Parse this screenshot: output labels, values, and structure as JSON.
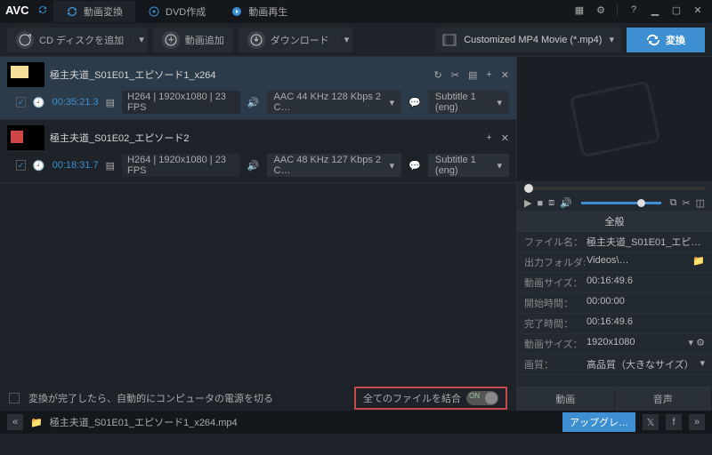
{
  "app": {
    "name": "AVC"
  },
  "main_tabs": {
    "video_convert": "動画変換",
    "dvd_create": "DVD作成",
    "video_play": "動画再生"
  },
  "toolbar": {
    "add_disc": "CD ディスクを追加",
    "add_video": "動画追加",
    "download": "ダウンロード",
    "format": "Customized MP4 Movie (*.mp4)",
    "convert": "変換"
  },
  "items": [
    {
      "name": "極主夫道_S01E01_エピソード1_x264",
      "dur": "00:35:21.3",
      "codec": "H264 | 1920x1080 | 23 FPS",
      "audio": "AAC 44 KHz 128 Kbps 2 C…",
      "sub": "Subtitle 1 (eng)"
    },
    {
      "name": "極主夫道_S01E02_エピソード2",
      "dur": "00:18:31.7",
      "codec": "H264 | 1920x1080 | 23 FPS",
      "audio": "AAC 48 KHz 127 Kbps 2 C…",
      "sub": "Subtitle 1 (eng)"
    }
  ],
  "bottom": {
    "shutdown": "変換が完了したら、自動的にコンピュータの電源を切る",
    "merge": "全てのファイルを結合",
    "merge_state": "ON"
  },
  "side": {
    "general": "全般",
    "rows": [
      {
        "k": "ファイル名：",
        "v": "極主夫道_S01E01_エピソー…"
      },
      {
        "k": "出力フォルダ:",
        "v": "Videos\\…"
      },
      {
        "k": "動画サイズ：",
        "v": "00:16:49.6"
      },
      {
        "k": "開始時間：",
        "v": "00:00:00"
      },
      {
        "k": "完了時間：",
        "v": "00:16:49.6"
      },
      {
        "k": "動画サイズ：",
        "v": "1920x1080"
      },
      {
        "k": "画質：",
        "v": "高品質（大きなサイズ）"
      }
    ],
    "tab_video": "動画",
    "tab_audio": "音声"
  },
  "status": {
    "file": "極主夫道_S01E01_エピソード1_x264.mp4",
    "upgrade": "アップグレ…"
  }
}
